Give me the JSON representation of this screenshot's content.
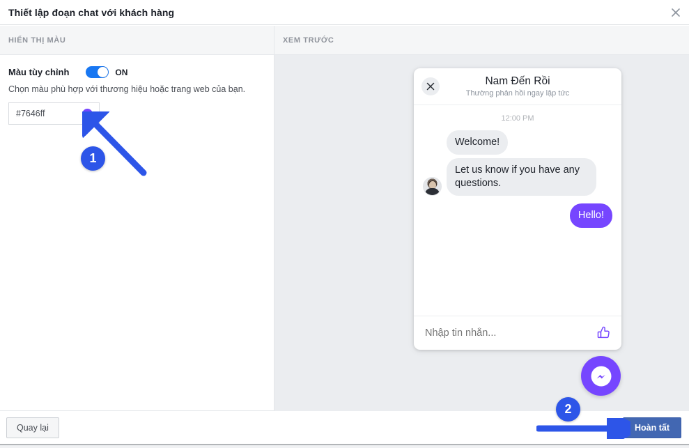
{
  "window": {
    "title": "Thiết lập đoạn chat với khách hàng",
    "close_icon": "close-icon"
  },
  "sections": {
    "left_header": "HIỂN THỊ MÀU",
    "right_header": "XEM TRƯỚC"
  },
  "settings": {
    "custom_color_label": "Màu tùy chỉnh",
    "toggle_state": "ON",
    "helper_text": "Chọn màu phù hợp với thương hiệu hoặc trang web của bạn.",
    "color_value": "#7646ff",
    "accent_color": "#7646ff"
  },
  "preview": {
    "close_icon": "close-icon",
    "page_name": "Nam Đến Rồi",
    "response_time": "Thường phản hồi ngay lập tức",
    "timestamp": "12:00 PM",
    "messages": [
      {
        "direction": "in",
        "text": "Welcome!",
        "has_avatar": false
      },
      {
        "direction": "in",
        "text": "Let us know if you have any questions.",
        "has_avatar": true
      },
      {
        "direction": "out",
        "text": "Hello!",
        "has_avatar": false
      }
    ],
    "input_placeholder": "Nhập tin nhắn...",
    "thumb_icon": "thumbs-up-icon",
    "fab_icon": "messenger-logo-icon"
  },
  "footer": {
    "back_label": "Quay lại",
    "done_label": "Hoàn tất"
  },
  "annotations": {
    "step_one": "1",
    "step_two": "2",
    "arrow_color": "#2d55e8"
  }
}
